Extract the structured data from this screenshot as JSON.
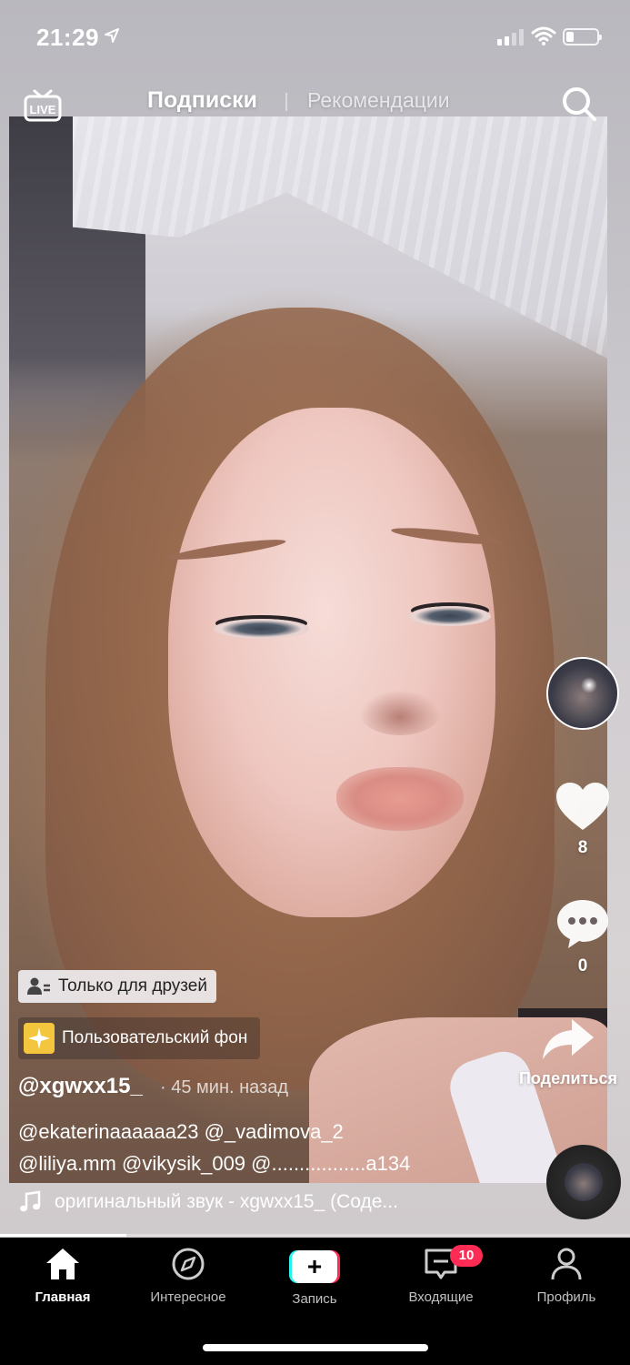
{
  "status_bar": {
    "time": "21:29",
    "location_icon": "location-arrow-icon",
    "signal_icon": "cellular-signal-icon",
    "wifi_icon": "wifi-icon",
    "battery_icon": "battery-icon"
  },
  "top_nav": {
    "live_label": "LIVE",
    "tab_following": "Подписки",
    "tab_for_you": "Рекомендации",
    "search_icon": "search-icon"
  },
  "actions": {
    "likes": "8",
    "comments": "0",
    "share_label": "Поделиться"
  },
  "caption": {
    "friends_only_label": "Только для друзей",
    "effect_label": "Пользовательский фон",
    "username": "@xgwxx15_",
    "time_ago": "· 45 мин. назад",
    "mentions_line1": "@ekaterinaaaaaa23 @_vadimova_2",
    "mentions_line2": "@liliya.mm @vikysik_009 @.................a134",
    "sound": "оригинальный звук - xgwxx15_ (Соде..."
  },
  "playback": {
    "progress_fraction": 0.2
  },
  "tab_bar": {
    "home": "Главная",
    "discover": "Интересное",
    "record": "Запись",
    "inbox": "Входящие",
    "inbox_badge": "10",
    "profile": "Профиль"
  },
  "colors": {
    "accent_red": "#fe2c55",
    "accent_cyan": "#25f4ee",
    "effect_yellow": "#f4c63d"
  }
}
